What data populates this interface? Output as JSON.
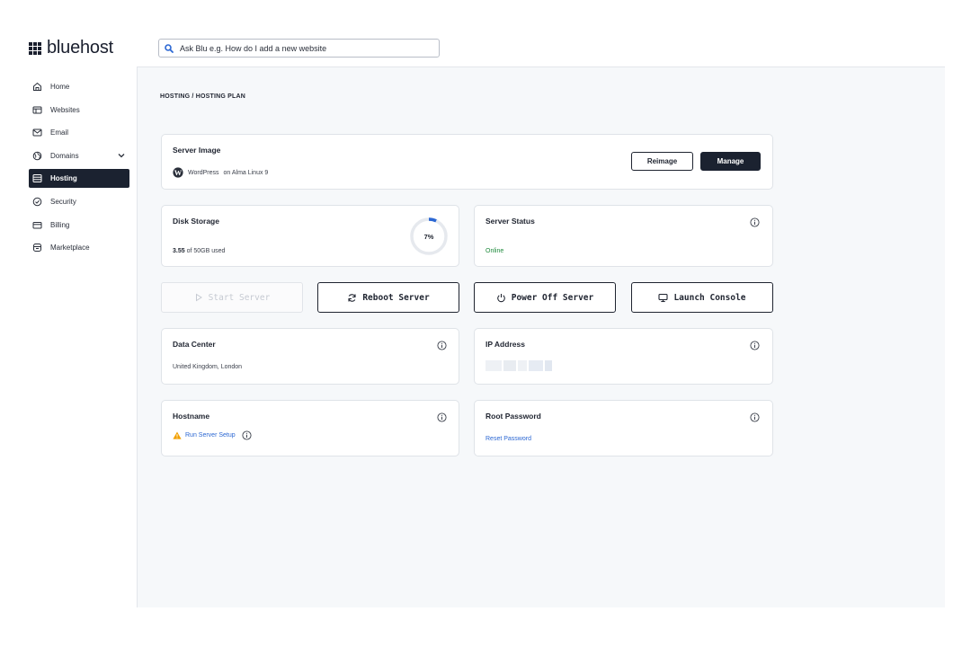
{
  "brand": {
    "name": "bluehost"
  },
  "search": {
    "placeholder": "Ask Blu e.g. How do I add a new website"
  },
  "sidebar": {
    "items": [
      {
        "label": "Home",
        "icon": "home-icon"
      },
      {
        "label": "Websites",
        "icon": "websites-icon"
      },
      {
        "label": "Email",
        "icon": "email-icon"
      },
      {
        "label": "Domains",
        "icon": "globe-icon"
      },
      {
        "label": "Hosting",
        "icon": "server-icon",
        "active": true
      },
      {
        "label": "Security",
        "icon": "shield-icon"
      },
      {
        "label": "Billing",
        "icon": "credit-card-icon"
      },
      {
        "label": "Marketplace",
        "icon": "store-icon"
      }
    ]
  },
  "breadcrumb": "HOSTING / HOSTING PLAN",
  "server_image": {
    "title": "Server Image",
    "os_name": "WordPress",
    "os_detail": "on Alma Linux 9",
    "reimage_label": "Reimage",
    "manage_label": "Manage"
  },
  "disk": {
    "title": "Disk Storage",
    "used": "3.55",
    "used_suffix": "of 50GB used",
    "percent_label": "7%",
    "percent": 7
  },
  "server_status": {
    "title": "Server Status",
    "value": "Online"
  },
  "actions": {
    "start": "Start Server",
    "reboot": "Reboot Server",
    "power_off": "Power Off Server",
    "console": "Launch Console"
  },
  "data_center": {
    "title": "Data Center",
    "value": "United Kingdom, London"
  },
  "ip": {
    "title": "IP Address"
  },
  "hostname": {
    "title": "Hostname",
    "action": "Run Server Setup"
  },
  "root_password": {
    "title": "Root Password",
    "action": "Reset Password"
  },
  "colors": {
    "accent": "#2b67d3",
    "dark": "#1b2230",
    "online": "#1e8a3c",
    "warning": "#f2a000"
  }
}
